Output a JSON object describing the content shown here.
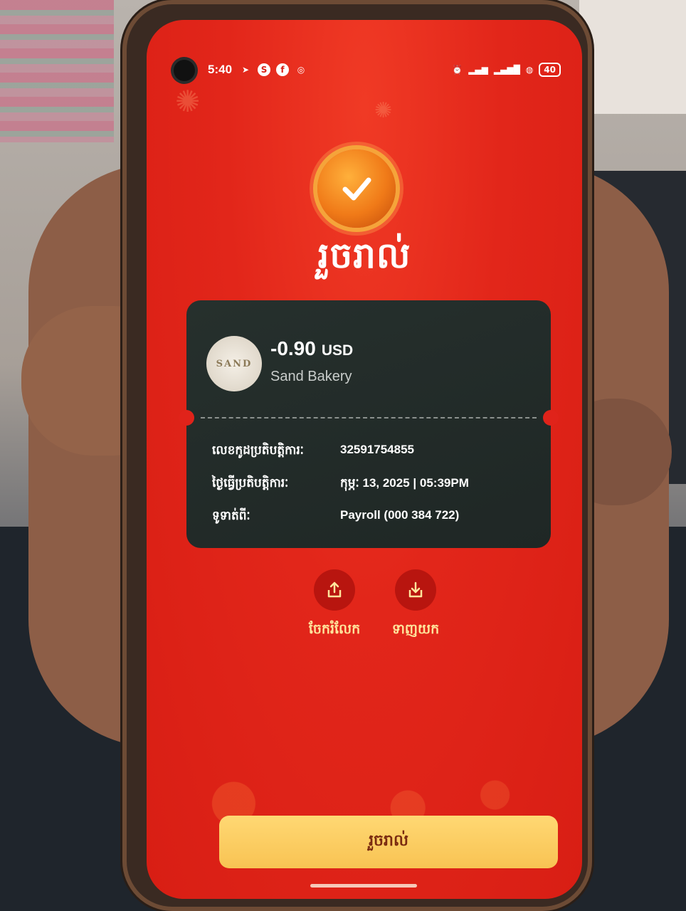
{
  "status_bar": {
    "time": "5:40",
    "battery": "40"
  },
  "success": {
    "title": "រួចរាល់"
  },
  "transaction": {
    "amount": "-0.90",
    "currency": "USD",
    "merchant": "Sand Bakery",
    "merchant_logo_text": "SAND",
    "details": [
      {
        "label": "លេខកូដប្រតិបត្តិការៈ",
        "value": "32591754855"
      },
      {
        "label": "ថ្ងៃធ្វើប្រតិបត្តិការៈ",
        "value": "កុម្ភៈ 13, 2025 | 05:39PM"
      },
      {
        "label": "ទូទាត់ពីៈ",
        "value": "Payroll (000 384 722)"
      }
    ]
  },
  "actions": {
    "share_label": "ចែករំលែក",
    "download_label": "ទាញយក"
  },
  "footer": {
    "done_label": "រួចរាល់"
  },
  "colors": {
    "screen_red": "#e2261a",
    "ticket_bg": "#26302d",
    "button_yellow": "#f8c353",
    "badge_orange": "#f07a18"
  }
}
